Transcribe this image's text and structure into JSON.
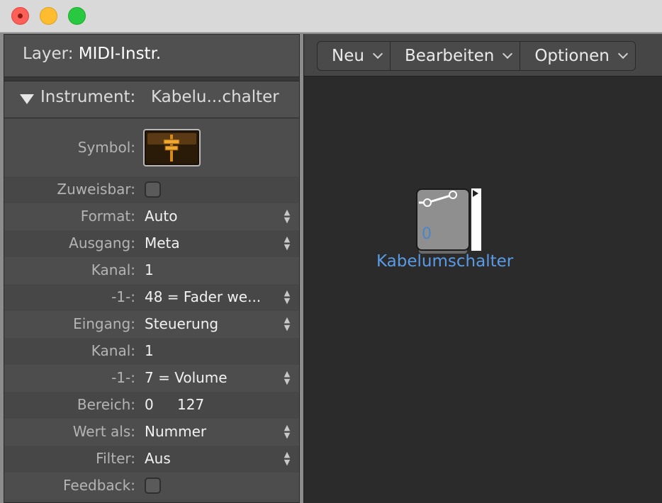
{
  "window": {
    "controls": [
      "close",
      "minimize",
      "maximize"
    ]
  },
  "inspector": {
    "layer_label": "Layer:",
    "layer_value": "MIDI-Instr.",
    "instrument_label": "Instrument:",
    "instrument_value": "Kabelu...chalter",
    "rows": [
      {
        "label": "Symbol:",
        "type": "symbol",
        "icon": "fader-symbol-icon"
      },
      {
        "label": "Zuweisbar:",
        "type": "checkbox",
        "checked": false
      },
      {
        "label": "Format:",
        "value": "Auto",
        "type": "popup"
      },
      {
        "label": "Ausgang:",
        "value": "Meta",
        "type": "popup"
      },
      {
        "label": "Kanal:",
        "value": "1",
        "type": "text"
      },
      {
        "label": "-1-:",
        "value": "48 = Fader we...",
        "type": "popup"
      },
      {
        "label": "Eingang:",
        "value": "Steuerung",
        "type": "popup"
      },
      {
        "label": "Kanal:",
        "value": "1",
        "type": "text"
      },
      {
        "label": "-1-:",
        "value": "7 = Volume",
        "type": "popup"
      },
      {
        "label": "Bereich:",
        "value": "0",
        "value_high": "127",
        "type": "range"
      },
      {
        "label": "Wert als:",
        "value": "Nummer",
        "type": "popup"
      },
      {
        "label": "Filter:",
        "value": "Aus",
        "type": "popup"
      },
      {
        "label": "Feedback:",
        "type": "checkbox",
        "checked": false
      }
    ]
  },
  "toolbar": {
    "menus": [
      {
        "label": "Neu"
      },
      {
        "label": "Bearbeiten"
      },
      {
        "label": "Optionen"
      }
    ]
  },
  "canvas": {
    "object_name": "Kabelumschalter",
    "object_value": "0"
  },
  "colors": {
    "accent_blue": "#5b9be6",
    "panel": "#4a4a4a",
    "canvas": "#2b2b2b"
  }
}
